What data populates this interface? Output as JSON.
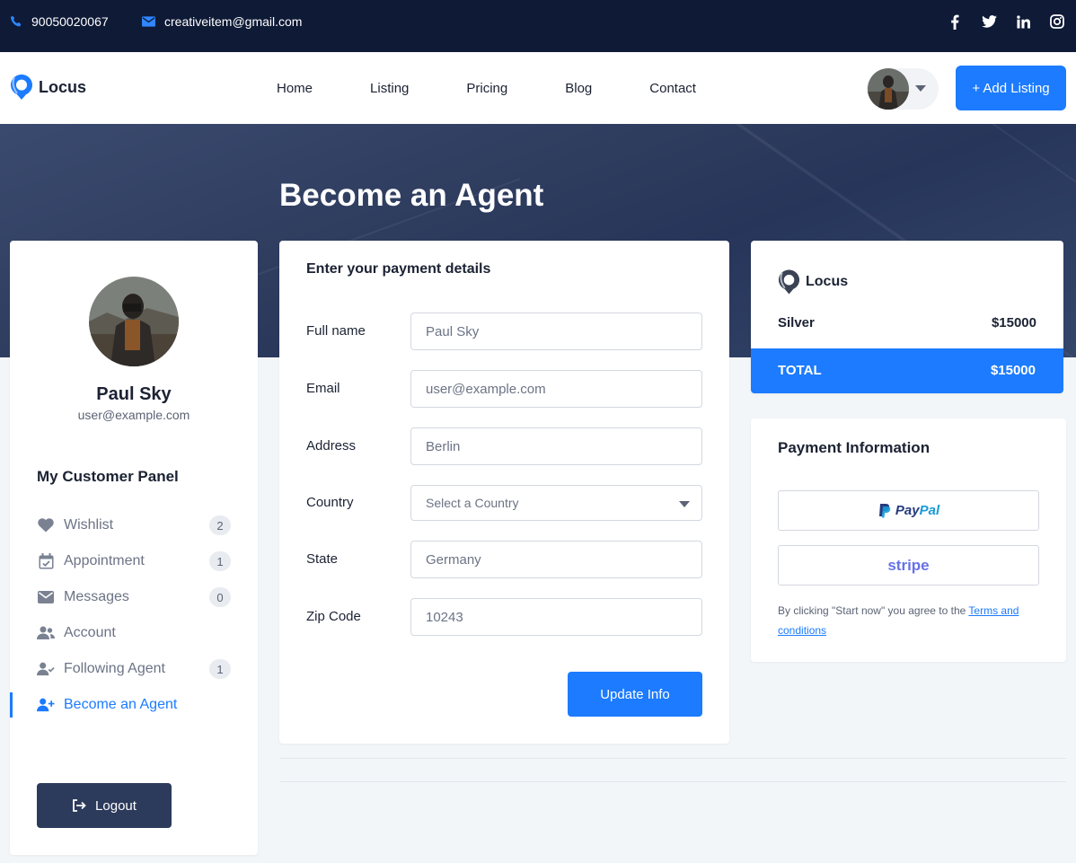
{
  "topbar": {
    "phone": "90050020067",
    "email": "creativeitem@gmail.com",
    "social": [
      "facebook-icon",
      "twitter-icon",
      "linkedin-icon",
      "instagram-icon"
    ]
  },
  "nav": {
    "brand": "Locus",
    "links": [
      "Home",
      "Listing",
      "Pricing",
      "Blog",
      "Contact"
    ],
    "add_listing": "+ Add Listing"
  },
  "hero": {
    "title": "Become an Agent"
  },
  "profile": {
    "name": "Paul Sky",
    "email": "user@example.com",
    "panel_title": "My Customer Panel",
    "items": [
      {
        "label": "Wishlist",
        "icon": "heart-icon",
        "badge": "2"
      },
      {
        "label": "Appointment",
        "icon": "calendar-icon",
        "badge": "1"
      },
      {
        "label": "Messages",
        "icon": "envelope-icon",
        "badge": "0"
      },
      {
        "label": "Account",
        "icon": "users-icon",
        "badge": null
      },
      {
        "label": "Following Agent",
        "icon": "user-check-icon",
        "badge": "1"
      },
      {
        "label": "Become an Agent",
        "icon": "user-plus-icon",
        "badge": null,
        "active": true
      }
    ],
    "logout": "Logout"
  },
  "form": {
    "title": "Enter your payment details",
    "fields": {
      "full_name": {
        "label": "Full name",
        "value": "Paul Sky"
      },
      "email": {
        "label": "Email",
        "value": "user@example.com"
      },
      "address": {
        "label": "Address",
        "value": "Berlin"
      },
      "country": {
        "label": "Country",
        "value": "Select a Country"
      },
      "state": {
        "label": "State",
        "value": "Germany"
      },
      "zip": {
        "label": "Zip Code",
        "value": "10243"
      }
    },
    "submit": "Update Info"
  },
  "summary": {
    "brand": "Locus",
    "plan": "Silver",
    "plan_price": "$15000",
    "total_label": "TOTAL",
    "total_price": "$15000"
  },
  "payment": {
    "title": "Payment Information",
    "paypal": "PayPal",
    "stripe": "stripe",
    "terms_text": "By clicking \"Start now\" you agree to the ",
    "terms_link": "Terms and conditions"
  },
  "colors": {
    "accent": "#1c7bff",
    "topbar": "#0e1a36",
    "hero": "#2e3c5e",
    "logout": "#2c3a5c"
  }
}
